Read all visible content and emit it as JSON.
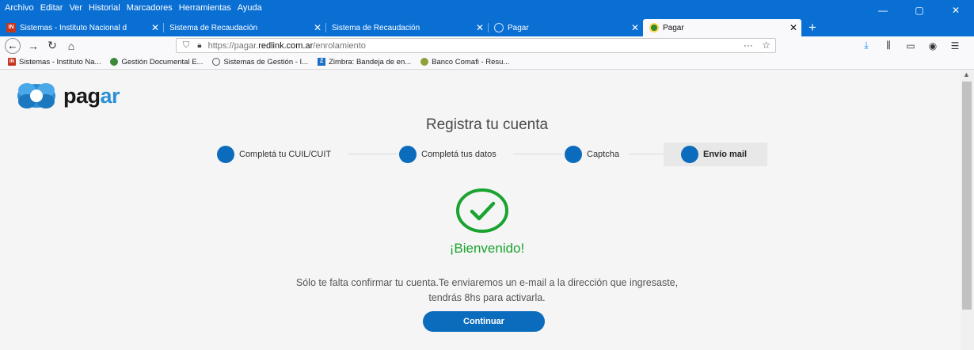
{
  "browser": {
    "menu": [
      "Archivo",
      "Editar",
      "Ver",
      "Historial",
      "Marcadores",
      "Herramientas",
      "Ayuda"
    ],
    "window_controls": {
      "minimize": "—",
      "maximize": "▢",
      "close": "✕"
    },
    "tabs": [
      {
        "title": "Sistemas - Instituto Nacional d",
        "favicon": "inr",
        "close": "✕"
      },
      {
        "title": "Sistema de Recaudación",
        "favicon": "none",
        "close": "✕"
      },
      {
        "title": "Sistema de Recaudación",
        "favicon": "none",
        "close": "✕"
      },
      {
        "title": "Pagar",
        "favicon": "globe",
        "close": "✕"
      },
      {
        "title": "Pagar",
        "favicon": "pagar",
        "close": "✕",
        "active": true
      }
    ],
    "new_tab": "+",
    "url": {
      "prefix": "https://pagar.",
      "host": "redlink.com.ar",
      "path": "/enrolamiento",
      "more": "···",
      "star": "☆"
    },
    "bookmarks": [
      {
        "label": "Sistemas - Instituto Na...",
        "icon": "inr-icon"
      },
      {
        "label": "Gestión Documental E...",
        "icon": "doc-icon"
      },
      {
        "label": "Sistemas de Gestión - I...",
        "icon": "globe-icon"
      },
      {
        "label": "Zimbra: Bandeja de en...",
        "icon": "zimbra-icon"
      },
      {
        "label": "Banco Comafi - Resu...",
        "icon": "comafi-icon"
      }
    ]
  },
  "page": {
    "logo": {
      "word_dark": "pag",
      "word_accent": "ar"
    },
    "title": "Registra tu cuenta",
    "steps": [
      {
        "label": "Completá tu CUIL/CUIT"
      },
      {
        "label": "Completá tus datos"
      },
      {
        "label": "Captcha"
      },
      {
        "label": "Envío mail",
        "current": true
      }
    ],
    "welcome": "¡Bienvenido!",
    "message_line1": "Sólo te falta confirmar tu cuenta.Te enviaremos un e-mail a la dirección que ingresaste,",
    "message_line2": "tendrás 8hs para activarla.",
    "continue_label": "Continuar"
  },
  "colors": {
    "brand_blue": "#0b6cbd",
    "success_green": "#1aa32f",
    "titlebar": "#0a6fd3"
  }
}
